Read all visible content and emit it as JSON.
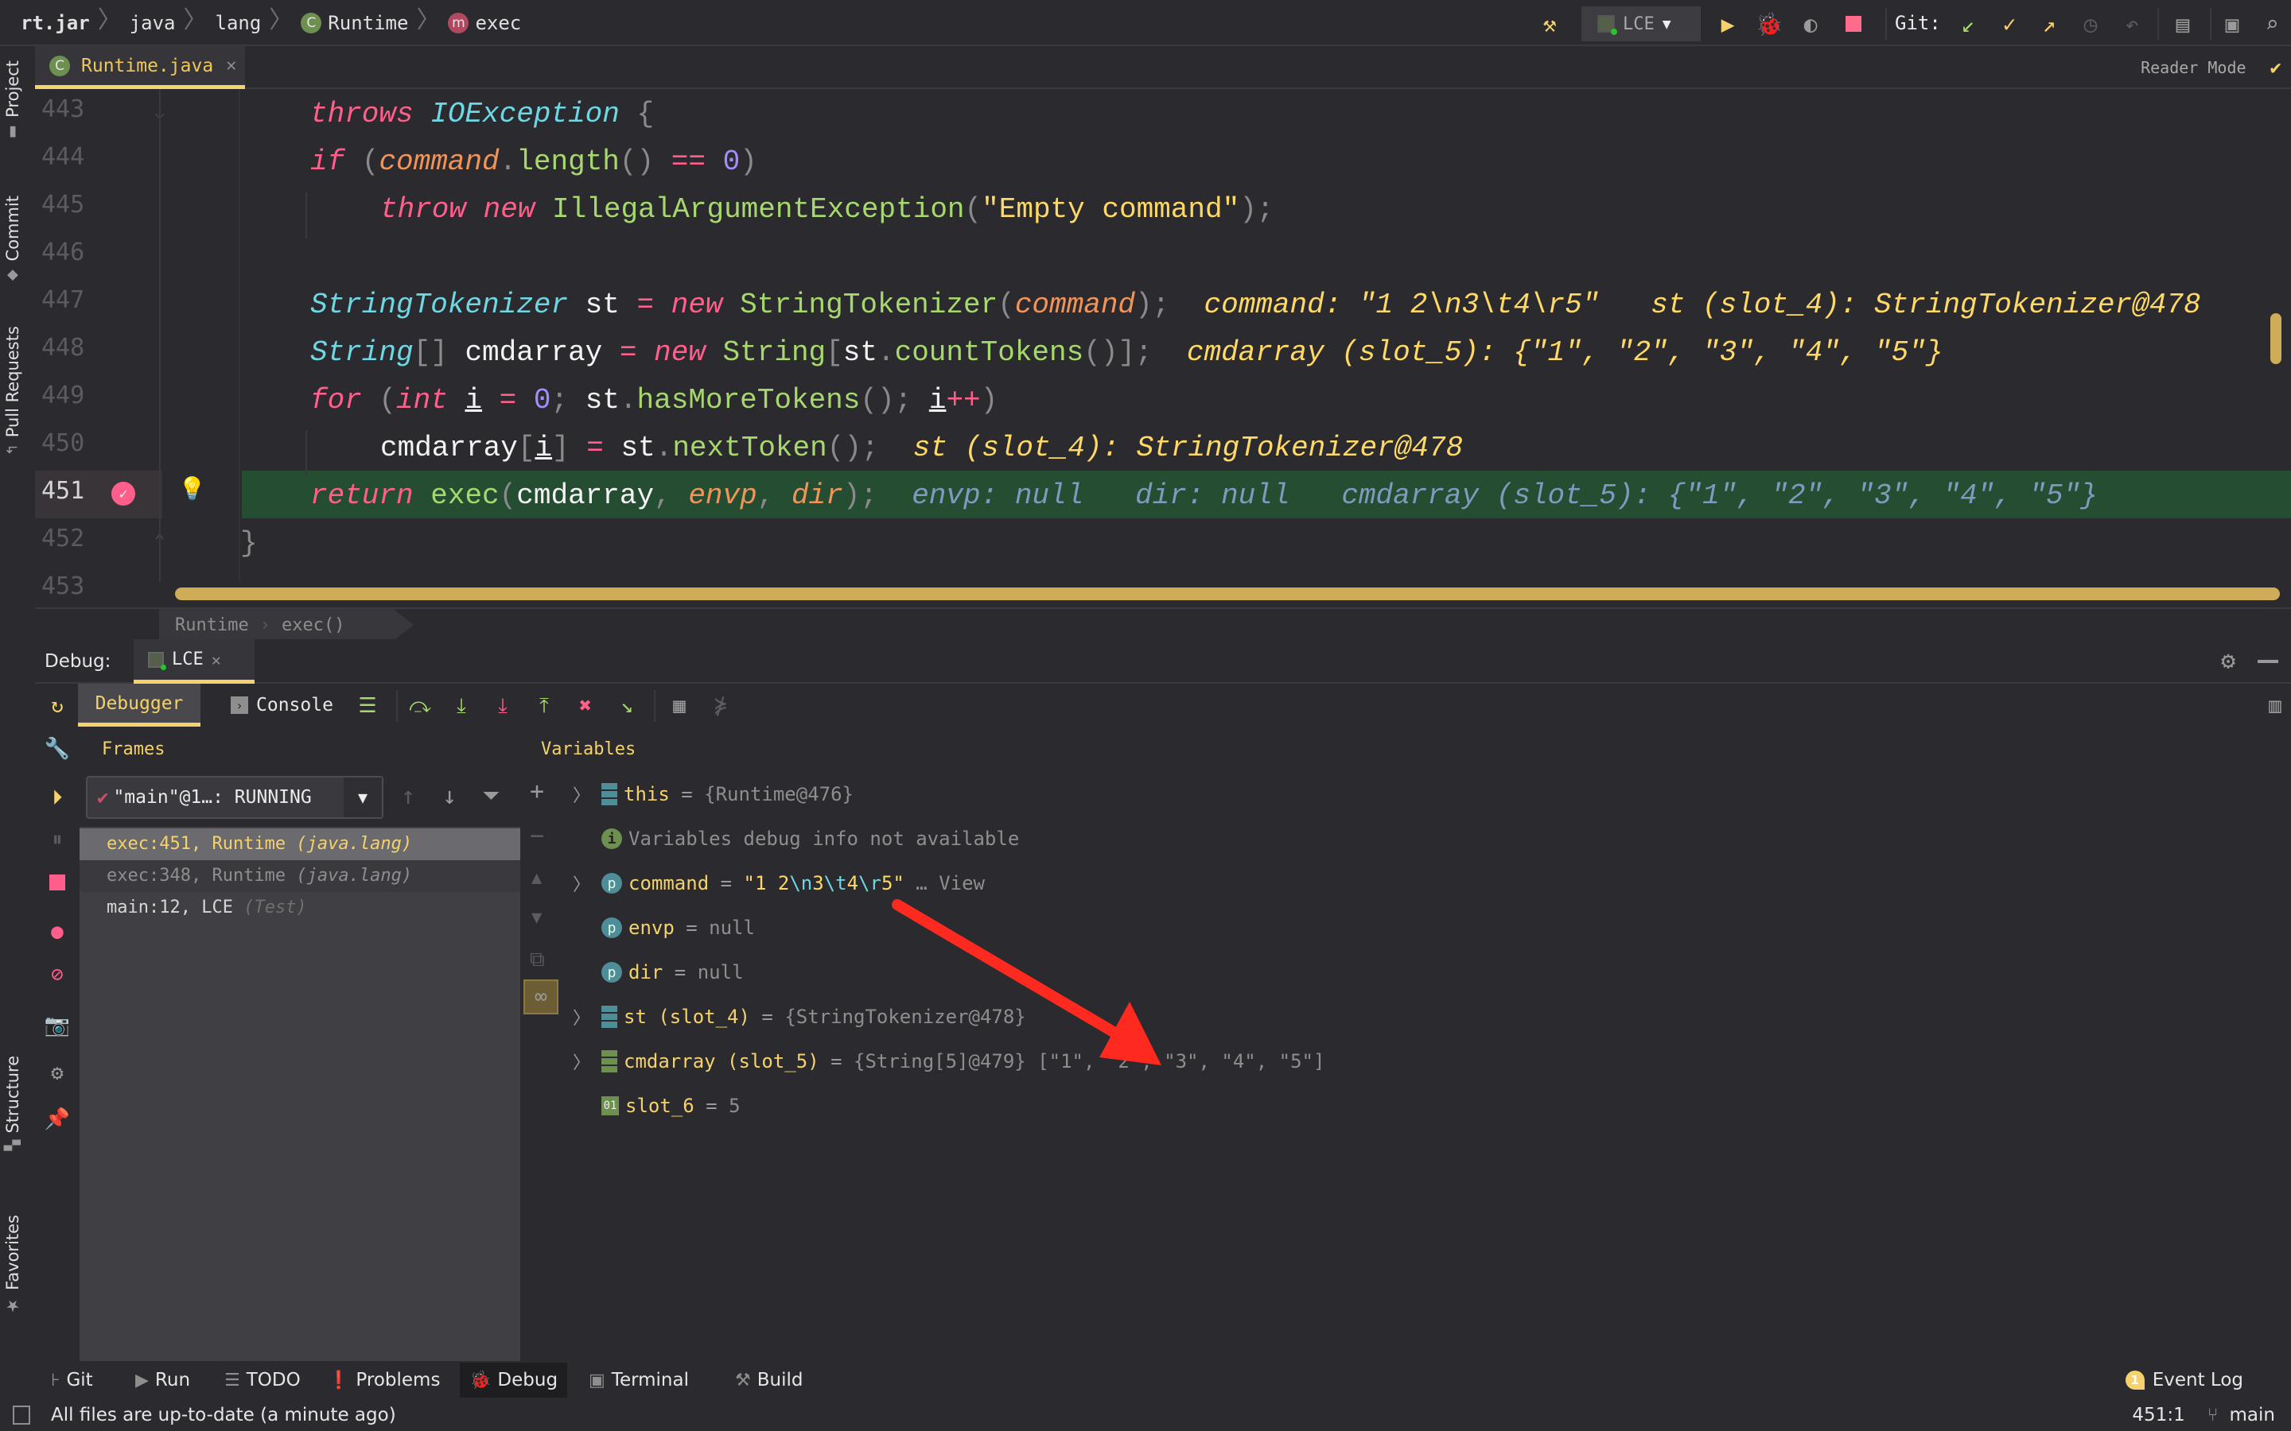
{
  "navbar": {
    "breadcrumbs": [
      {
        "label": "rt.jar",
        "icon": null
      },
      {
        "label": "java",
        "icon": null
      },
      {
        "label": "lang",
        "icon": null
      },
      {
        "label": "Runtime",
        "icon": "class-icon",
        "icon_letter": "C"
      },
      {
        "label": "exec",
        "icon": "method-icon",
        "icon_letter": "m"
      }
    ],
    "run_config": "LCE",
    "git_label": "Git:"
  },
  "left_tool_strip": {
    "items": [
      "Project",
      "Commit",
      "Pull Requests",
      "Structure",
      "Favorites"
    ]
  },
  "editor": {
    "tab": {
      "label": "Runtime.java",
      "icon_letter": "C"
    },
    "reader_mode_label": "Reader Mode",
    "current_line": 451,
    "lines": [
      {
        "num": "443",
        "text": "throws IOException {"
      },
      {
        "num": "444",
        "text": "if (command.length() == 0)"
      },
      {
        "num": "445",
        "text": "throw new IllegalArgumentException(\"Empty command\");"
      },
      {
        "num": "446",
        "text": ""
      },
      {
        "num": "447",
        "text": "StringTokenizer st = new StringTokenizer(command);",
        "hint": "command: \"1 2\\n3\\t4\\r5\"   st (slot_4): StringTokenizer@478"
      },
      {
        "num": "448",
        "text": "String[] cmdarray = new String[st.countTokens()];",
        "hint": "cmdarray (slot_5): {\"1\", \"2\", \"3\", \"4\", \"5\"}"
      },
      {
        "num": "449",
        "text": "for (int i = 0; st.hasMoreTokens(); i++)"
      },
      {
        "num": "450",
        "text": "cmdarray[i] = st.nextToken();",
        "hint": "st (slot_4): StringTokenizer@478"
      },
      {
        "num": "451",
        "text": "return exec(cmdarray, envp, dir);",
        "hint": "envp: null   dir: null   cmdarray (slot_5): {\"1\", \"2\", \"3\", \"4\", \"5\"}"
      },
      {
        "num": "452",
        "text": "}"
      },
      {
        "num": "453",
        "text": ""
      }
    ],
    "inline_hints": {
      "l447_a": "command: \"1 2\\n3\\t4\\r5\"",
      "l447_b": "st (slot_4): StringTokenizer@478",
      "l448": "cmdarray (slot_5): {\"1\", \"2\", \"3\", \"4\", \"5\"}",
      "l450": "st (slot_4): StringTokenizer@478",
      "l451_a": "envp: null",
      "l451_b": "dir: null",
      "l451_c": "cmdarray (slot_5): {\"1\", \"2\", \"3\", \"4\", \"5\"}"
    },
    "breadcrumbs": [
      "Runtime",
      "exec()"
    ]
  },
  "debug": {
    "title": "Debug:",
    "session_tab": "LCE",
    "tabs": {
      "debugger": "Debugger",
      "console": "Console"
    },
    "frames": {
      "header": "Frames",
      "thread": "\"main\"@1…: RUNNING",
      "items": [
        {
          "method": "exec:451, Runtime",
          "pkg": "(java.lang)",
          "selected": true
        },
        {
          "method": "exec:348, Runtime",
          "pkg": "(java.lang)",
          "selected": false
        },
        {
          "method": "main:12, LCE",
          "pkg": "(Test)",
          "selected": false
        }
      ]
    },
    "variables": {
      "header": "Variables",
      "items": [
        {
          "name": "this",
          "eq": " = ",
          "value": "{Runtime@476}",
          "icon": "object",
          "expandable": true
        },
        {
          "name": "",
          "eq": "",
          "value": "Variables debug info not available",
          "icon": "info",
          "expandable": false
        },
        {
          "name": "command",
          "eq": " = ",
          "value": "\"1 2\\n3\\t4\\r5\"",
          "suffix": " … View",
          "icon": "param",
          "expandable": true
        },
        {
          "name": "envp",
          "eq": " = ",
          "value": "null",
          "icon": "param",
          "expandable": false
        },
        {
          "name": "dir",
          "eq": " = ",
          "value": "null",
          "icon": "param",
          "expandable": false
        },
        {
          "name": "st (slot_4)",
          "eq": " = ",
          "value": "{StringTokenizer@478}",
          "icon": "object",
          "expandable": true
        },
        {
          "name": "cmdarray (slot_5)",
          "eq": " = ",
          "value": "{String[5]@479} [\"1\", \"2\", \"3\", \"4\", \"5\"]",
          "icon": "array",
          "expandable": true
        },
        {
          "name": "slot_6",
          "eq": " = ",
          "value": "5",
          "icon": "primitive",
          "expandable": false
        }
      ]
    }
  },
  "bottom_bar": {
    "items": [
      "Git",
      "Run",
      "TODO",
      "Problems",
      "Debug",
      "Terminal",
      "Build"
    ],
    "active": "Debug",
    "event_log": "Event Log",
    "event_count": "1"
  },
  "status_bar": {
    "message": "All files are up-to-date (a minute ago)",
    "position": "451:1",
    "branch": "main"
  },
  "colors": {
    "accent": "#f5d26b",
    "exec_line": "#244d31",
    "breakpoint": "#ff5f8a",
    "arrow": "#ff2a1f"
  }
}
